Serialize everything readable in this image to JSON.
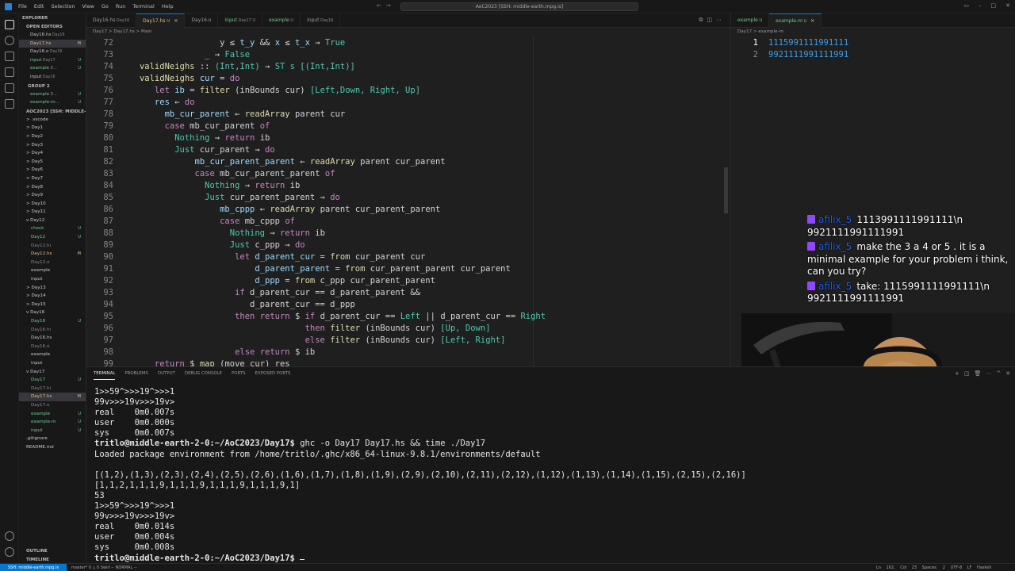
{
  "titlebar": {
    "menu": [
      "File",
      "Edit",
      "Selection",
      "View",
      "Go",
      "Run",
      "Terminal",
      "Help"
    ],
    "search": "AoC2023 [SSH: middle-earth.mpg.is]"
  },
  "sidebar": {
    "title": "EXPLORER",
    "open_editors": "OPEN EDITORS",
    "group2": "GROUP 2",
    "workspace": "AOC2023 [SSH: MIDDLE-E...",
    "outline": "OUTLINE",
    "timeline": "TIMELINE",
    "open_files": [
      {
        "name": "Day16.hs",
        "hint": "Day16"
      },
      {
        "name": "Day17.hs",
        "hint": "",
        "badge": "M"
      },
      {
        "name": "Day16.o",
        "hint": "Day16"
      },
      {
        "name": "input",
        "hint": "Day17",
        "badge": "U"
      },
      {
        "name": "example",
        "hint": "D...",
        "badge": "U"
      },
      {
        "name": "input",
        "hint": "Day16"
      }
    ],
    "group2_files": [
      {
        "name": "example",
        "hint": "D...",
        "badge": "U"
      },
      {
        "name": "example-m...",
        "hint": "",
        "badge": "U"
      }
    ],
    "tree": [
      {
        "name": "> .vscode",
        "badge": ""
      },
      {
        "name": "> Day1",
        "badge": ""
      },
      {
        "name": "> Day2",
        "badge": ""
      },
      {
        "name": "> Day3",
        "badge": ""
      },
      {
        "name": "> Day4",
        "badge": ""
      },
      {
        "name": "> Day5",
        "badge": ""
      },
      {
        "name": "> Day6",
        "badge": ""
      },
      {
        "name": "> Day7",
        "badge": ""
      },
      {
        "name": "> Day8",
        "badge": ""
      },
      {
        "name": "> Day9",
        "badge": ""
      },
      {
        "name": "> Day10",
        "badge": ""
      },
      {
        "name": "> Day11",
        "badge": ""
      },
      {
        "name": "v Day12",
        "badge": ""
      },
      {
        "name": "check",
        "badge": "U"
      },
      {
        "name": "Day12",
        "badge": "U"
      },
      {
        "name": "Day12.hi",
        "badge": ""
      },
      {
        "name": "Day12.hs",
        "badge": "M"
      },
      {
        "name": "Day12.o",
        "badge": ""
      },
      {
        "name": "example",
        "badge": ""
      },
      {
        "name": "input",
        "badge": ""
      },
      {
        "name": "> Day13",
        "badge": ""
      },
      {
        "name": "> Day14",
        "badge": ""
      },
      {
        "name": "> Day15",
        "badge": ""
      },
      {
        "name": "v Day16",
        "badge": ""
      },
      {
        "name": "Day16",
        "badge": "U"
      },
      {
        "name": "Day16.hi",
        "badge": ""
      },
      {
        "name": "Day16.hs",
        "badge": ""
      },
      {
        "name": "Day16.o",
        "badge": ""
      },
      {
        "name": "example",
        "badge": ""
      },
      {
        "name": "input",
        "badge": ""
      },
      {
        "name": "v Day17",
        "badge": ""
      },
      {
        "name": "Day17",
        "badge": "U"
      },
      {
        "name": "Day17.hi",
        "badge": ""
      },
      {
        "name": "Day17.hs",
        "badge": "M"
      },
      {
        "name": "Day17.o",
        "badge": ""
      },
      {
        "name": "example",
        "badge": "U"
      },
      {
        "name": "example-m",
        "badge": "U"
      },
      {
        "name": "input",
        "badge": "U"
      },
      {
        "name": ".gitignore",
        "badge": ""
      },
      {
        "name": "README.md",
        "badge": ""
      }
    ]
  },
  "tabs": [
    {
      "label": "Day16.hs",
      "hint": "Day16",
      "active": false
    },
    {
      "label": "Day17.hs",
      "hint": "M",
      "active": true
    },
    {
      "label": "Day16.o",
      "hint": "",
      "active": false
    },
    {
      "label": "input",
      "hint": "Day17 U",
      "active": false
    },
    {
      "label": "example",
      "hint": "U",
      "active": false
    },
    {
      "label": "input",
      "hint": "Day16",
      "active": false
    }
  ],
  "breadcrumb": "Day17 > Day17.hs > Main",
  "code_lines": [
    {
      "n": "72",
      "s": [
        [
          "o",
          "                   y "
        ],
        [
          "o",
          "≤"
        ],
        [
          "v",
          " t_y"
        ],
        [
          "o",
          " && "
        ],
        [
          "v",
          "x"
        ],
        [
          "o",
          " ≤ "
        ],
        [
          "v",
          "t_x"
        ],
        [
          "o",
          " → "
        ],
        [
          "t",
          "True"
        ]
      ]
    },
    {
      "n": "73",
      "s": [
        [
          "o",
          "                _ → "
        ],
        [
          "t",
          "False"
        ]
      ]
    },
    {
      "n": "74",
      "s": [
        [
          "f",
          "   validNeighs"
        ],
        [
          "o",
          " :: "
        ],
        [
          "t",
          "(Int,Int)"
        ],
        [
          "o",
          " → "
        ],
        [
          "t",
          "ST s [(Int,Int)]"
        ]
      ]
    },
    {
      "n": "75",
      "s": [
        [
          "f",
          "   validNeighs"
        ],
        [
          "v",
          " cur"
        ],
        [
          "o",
          " = "
        ],
        [
          "k",
          "do"
        ]
      ]
    },
    {
      "n": "76",
      "s": [
        [
          "k",
          "      let"
        ],
        [
          "v",
          " ib"
        ],
        [
          "o",
          " = "
        ],
        [
          "f",
          "filter"
        ],
        [
          "o",
          " (inBounds cur) "
        ],
        [
          "t",
          "[Left,Down, Right, Up]"
        ]
      ]
    },
    {
      "n": "77",
      "s": [
        [
          "v",
          "      res"
        ],
        [
          "o",
          " ← "
        ],
        [
          "k",
          "do"
        ]
      ]
    },
    {
      "n": "78",
      "s": [
        [
          "v",
          "        mb_cur_parent"
        ],
        [
          "o",
          " ← "
        ],
        [
          "f",
          "readArray"
        ],
        [
          "o",
          " parent cur"
        ]
      ]
    },
    {
      "n": "79",
      "s": [
        [
          "k",
          "        case"
        ],
        [
          "o",
          " mb_cur_parent "
        ],
        [
          "k",
          "of"
        ]
      ]
    },
    {
      "n": "80",
      "s": [
        [
          "t",
          "          Nothing"
        ],
        [
          "o",
          " → "
        ],
        [
          "k",
          "return"
        ],
        [
          "o",
          " ib"
        ]
      ]
    },
    {
      "n": "81",
      "s": [
        [
          "t",
          "          Just"
        ],
        [
          "o",
          " cur_parent → "
        ],
        [
          "k",
          "do"
        ]
      ]
    },
    {
      "n": "82",
      "s": [
        [
          "v",
          "              mb_cur_parent_parent"
        ],
        [
          "o",
          " ← "
        ],
        [
          "f",
          "readArray"
        ],
        [
          "o",
          " parent cur_parent"
        ]
      ]
    },
    {
      "n": "83",
      "s": [
        [
          "k",
          "              case"
        ],
        [
          "o",
          " mb_cur_parent_parent "
        ],
        [
          "k",
          "of"
        ]
      ]
    },
    {
      "n": "84",
      "s": [
        [
          "t",
          "                Nothing"
        ],
        [
          "o",
          " → "
        ],
        [
          "k",
          "return"
        ],
        [
          "o",
          " ib"
        ]
      ]
    },
    {
      "n": "85",
      "s": [
        [
          "t",
          "                Just"
        ],
        [
          "o",
          " cur_parent_parent → "
        ],
        [
          "k",
          "do"
        ]
      ]
    },
    {
      "n": "86",
      "s": [
        [
          "v",
          "                   mb_cppp"
        ],
        [
          "o",
          " ← "
        ],
        [
          "f",
          "readArray"
        ],
        [
          "o",
          " parent cur_parent_parent"
        ]
      ]
    },
    {
      "n": "87",
      "s": [
        [
          "k",
          "                   case"
        ],
        [
          "o",
          " mb_cppp "
        ],
        [
          "k",
          "of"
        ]
      ]
    },
    {
      "n": "88",
      "s": [
        [
          "t",
          "                     Nothing"
        ],
        [
          "o",
          " → "
        ],
        [
          "k",
          "return"
        ],
        [
          "o",
          " ib"
        ]
      ]
    },
    {
      "n": "89",
      "s": [
        [
          "t",
          "                     Just"
        ],
        [
          "o",
          " c_ppp → "
        ],
        [
          "k",
          "do"
        ]
      ]
    },
    {
      "n": "90",
      "s": [
        [
          "k",
          "                      let"
        ],
        [
          "v",
          " d_parent_cur"
        ],
        [
          "o",
          " = "
        ],
        [
          "f",
          "from"
        ],
        [
          "o",
          " cur_parent cur"
        ]
      ]
    },
    {
      "n": "91",
      "s": [
        [
          "v",
          "                          d_parent_parent"
        ],
        [
          "o",
          " = "
        ],
        [
          "f",
          "from"
        ],
        [
          "o",
          " cur_parent_parent cur_parent"
        ]
      ]
    },
    {
      "n": "92",
      "s": [
        [
          "v",
          "                          d_ppp"
        ],
        [
          "o",
          " = "
        ],
        [
          "f",
          "from"
        ],
        [
          "o",
          " c_ppp cur_parent_parent"
        ]
      ]
    },
    {
      "n": "93",
      "s": [
        [
          "k",
          "                      if"
        ],
        [
          "o",
          " d_parent_cur == d_parent_parent &&"
        ]
      ]
    },
    {
      "n": "94",
      "s": [
        [
          "o",
          "                         d_parent_cur == d_ppp"
        ]
      ]
    },
    {
      "n": "95",
      "s": [
        [
          "k",
          "                      then"
        ],
        [
          "k",
          " return"
        ],
        [
          "o",
          " $ "
        ],
        [
          "k",
          "if"
        ],
        [
          "o",
          " d_parent_cur == "
        ],
        [
          "t",
          "Left"
        ],
        [
          "o",
          " || d_parent_cur == "
        ],
        [
          "t",
          "Right"
        ]
      ]
    },
    {
      "n": "96",
      "s": [
        [
          "k",
          "                                    then"
        ],
        [
          "f",
          " filter"
        ],
        [
          "o",
          " (inBounds cur) "
        ],
        [
          "t",
          "[Up, Down]"
        ]
      ]
    },
    {
      "n": "97",
      "s": [
        [
          "k",
          "                                    else"
        ],
        [
          "f",
          " filter"
        ],
        [
          "o",
          " (inBounds cur) "
        ],
        [
          "t",
          "[Left, Right]"
        ]
      ]
    },
    {
      "n": "98",
      "s": [
        [
          "k",
          "                      else"
        ],
        [
          "k",
          " return"
        ],
        [
          "o",
          " $ ib"
        ]
      ]
    },
    {
      "n": "99",
      "s": [
        [
          "k",
          "      return"
        ],
        [
          "o",
          " $ "
        ],
        [
          "f",
          "map"
        ],
        [
          "o",
          " (move cur) res"
        ]
      ]
    }
  ],
  "right_group": {
    "tabs": [
      {
        "label": "example",
        "hint": "U",
        "active": false
      },
      {
        "label": "example-m",
        "hint": "U",
        "active": true
      }
    ],
    "breadcrumb": "Day17 > example-m",
    "lines": [
      {
        "n": "1",
        "text": "1115991111991111"
      },
      {
        "n": "2",
        "text": "9921111991111991"
      }
    ]
  },
  "chat": [
    {
      "user": "afilix_5",
      "text": "1113991111991111\\n 9921111991111991"
    },
    {
      "user": "afilix_5",
      "text": "make the 3 a 4 or 5 . it is a minimal example for your problem i think, can you try?"
    },
    {
      "user": "afilix_5",
      "text": "take: 1115991111991111\\n 9921111991111991"
    }
  ],
  "panel": {
    "tabs": [
      "TERMINAL",
      "PROBLEMS",
      "OUTPUT",
      "DEBUG CONSOLE",
      "PORTS",
      "EXPOSED PORTS"
    ],
    "terminal": [
      "1>>59^>>>19^>>>1",
      "99v>>>19v>>>19v>",
      "real    0m0.007s",
      "user    0m0.000s",
      "sys     0m0.007s",
      "tritlo@middle-earth-2-0:~/AoC2023/Day17$ ghc -o Day17 Day17.hs && time ./Day17",
      "Loaded package environment from /home/tritlo/.ghc/x86_64-linux-9.8.1/environments/default",
      "",
      "[(1,2),(1,3),(2,3),(2,4),(2,5),(2,6),(1,6),(1,7),(1,8),(1,9),(2,9),(2,10),(2,11),(2,12),(1,12),(1,13),(1,14),(1,15),(2,15),(2,16)]",
      "[1,1,2,1,1,1,9,1,1,1,9,1,1,1,9,1,1,1,9,1]",
      "53",
      "1>>59^>>>19^>>>1",
      "99v>>>19v>>>19v>",
      "real    0m0.014s",
      "user    0m0.004s",
      "sys     0m0.008s",
      "tritlo@middle-earth-2-0:~/AoC2023/Day17$ "
    ]
  },
  "status": {
    "remote": "SSH: middle-earth.mpg.is",
    "left": "master*   0 △ 0   Swirl  -- NORMAL --",
    "right": "Ln 162, Col 23   Spaces: 2   UTF-8   LF   Haskell"
  },
  "colors": {
    "accent": "#0078d4",
    "editor_bg": "#1f1f1f",
    "twitch": "#9146ff"
  }
}
